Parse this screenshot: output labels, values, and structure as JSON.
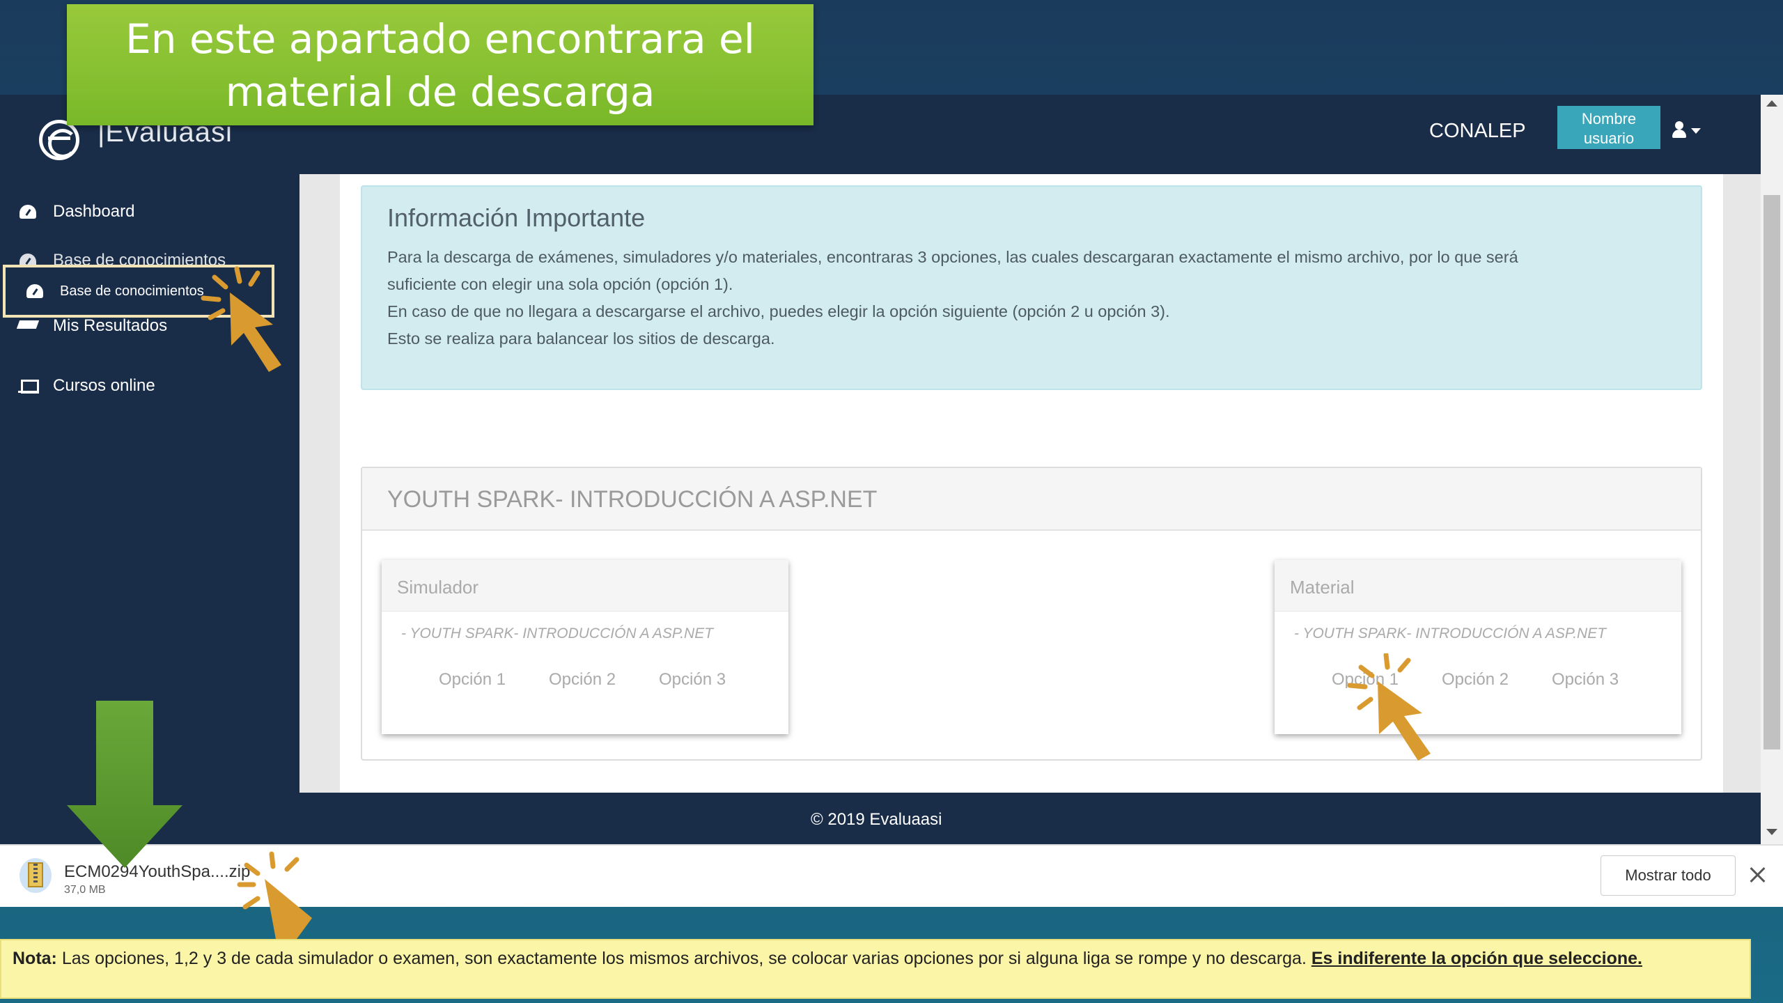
{
  "banner": {
    "line1": "En este apartado encontrara el",
    "line2": "material de descarga"
  },
  "app": {
    "logo_text": "|Evaluaasi",
    "org": "CONALEP",
    "user_line1": "Nombre",
    "user_line2": "usuario"
  },
  "sidebar": {
    "items": [
      {
        "label": "Dashboard",
        "icon": "dashboard-icon"
      },
      {
        "label": "Base de conocimientos",
        "icon": "dashboard-icon"
      },
      {
        "label": "Mis Resultados",
        "icon": "graduation-cap-icon"
      },
      {
        "label": "Cursos online",
        "icon": "laptop-icon"
      }
    ],
    "highlight_label": "Base de conocimientos"
  },
  "info": {
    "title": "Información Importante",
    "lines": [
      "Para la descarga de exámenes, simuladores y/o materiales, encontraras 3 opciones, las cuales descargaran exactamente el mismo archivo, por lo que será",
      "suficiente con elegir una sola opción (opción 1).",
      "En caso de que no llegara a descargarse el archivo, puedes elegir la opción siguiente (opción 2 u opción 3).",
      "Esto se realiza para balancear los sitios de descarga."
    ]
  },
  "course": {
    "title": "YOUTH SPARK- INTRODUCCIÓN A ASP.NET",
    "cards": [
      {
        "title": "Simulador",
        "subtitle": "- YOUTH SPARK- INTRODUCCIÓN A ASP.NET",
        "options": [
          "Opción 1",
          "Opción 2",
          "Opción 3"
        ]
      },
      {
        "title": "Material",
        "subtitle": "- YOUTH SPARK- INTRODUCCIÓN A ASP.NET",
        "options": [
          "Opción 1",
          "Opción 2",
          "Opción 3"
        ]
      }
    ]
  },
  "footer": {
    "text": "© 2019 Evaluaasi"
  },
  "download": {
    "file_name": "ECM0294YouthSpa....zip",
    "file_size": "37,0 MB",
    "show_all": "Mostrar todo"
  },
  "note": {
    "label": "Nota:",
    "text": " Las opciones, 1,2 y 3 de cada simulador o examen, son exactamente los mismos archivos, se colocar varias opciones por si alguna liga se rompe y no descarga. ",
    "emphasis": "Es indiferente la opción que seleccione."
  },
  "colors": {
    "sidebar": "#192d49",
    "accent": "#3aa6b9",
    "banner": "#86c031",
    "pointer": "#d99b2f",
    "arrow": "#5f9a2f"
  }
}
